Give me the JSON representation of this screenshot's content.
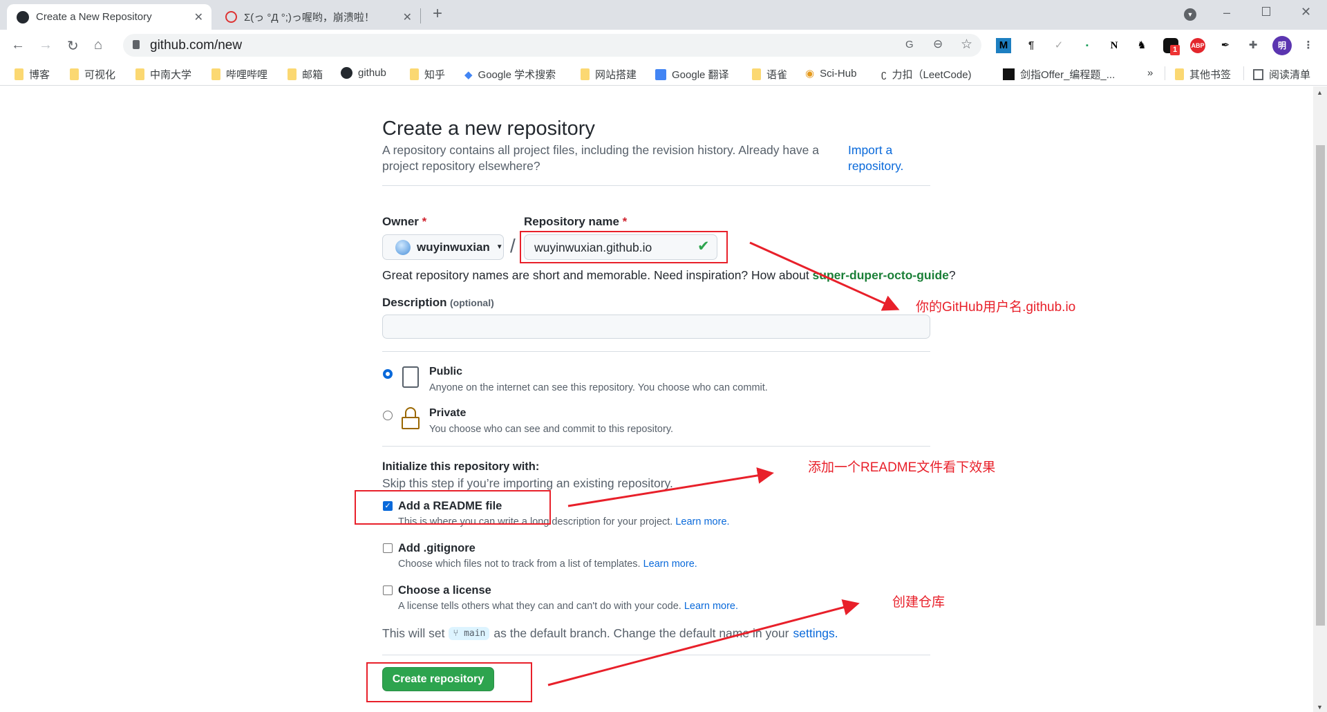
{
  "browser": {
    "tabs": [
      {
        "title": "Create a New Repository",
        "icon": "github-icon"
      },
      {
        "title": "Σ(っ °Д °;)っ喔哟，崩溃啦！",
        "icon": "bilibili-icon"
      }
    ],
    "new_tab": "+",
    "url": "github.com/new",
    "bookmarks": [
      "博客",
      "可视化",
      "中南大学",
      "哔哩哔哩",
      "邮箱",
      "github",
      "知乎",
      "Google 学术搜索",
      "网站搭建",
      "Google 翻译",
      "语雀",
      "Sci-Hub",
      "力扣（LeetCode)",
      "剑指Offer_编程题_..."
    ],
    "bookmarks_overflow": "»",
    "other_bookmarks": "其他书签",
    "reading_list": "阅读清单",
    "profile_initial": "明",
    "extension_badge": "1",
    "extensions": [
      "M",
      "¶",
      "✓",
      "▪",
      "N",
      "ABP"
    ]
  },
  "page": {
    "title": "Create a new repository",
    "subtitle": "A repository contains all project files, including the revision history. Already have a project repository elsewhere?",
    "import_link": "Import a repository.",
    "owner_label": "Owner",
    "required_mark": "*",
    "owner_value": "wuyinwuxian",
    "slash": "/",
    "repo_label": "Repository name",
    "repo_value": "wuyinwuxian.github.io",
    "hint_prefix": "Great repository names are short and memorable. Need inspiration? How about ",
    "hint_suggestion": "super-duper-octo-guide",
    "hint_suffix": "?",
    "description_label": "Description",
    "description_optional": "(optional)",
    "description_value": "",
    "visibility": [
      {
        "label": "Public",
        "desc": "Anyone on the internet can see this repository. You choose who can commit.",
        "selected": true
      },
      {
        "label": "Private",
        "desc": "You choose who can see and commit to this repository.",
        "selected": false
      }
    ],
    "init_title": "Initialize this repository with:",
    "init_skip": "Skip this step if you’re importing an existing repository.",
    "init_options": [
      {
        "label": "Add a README file",
        "desc": "This is where you can write a long description for your project.",
        "link": "Learn more.",
        "checked": true
      },
      {
        "label": "Add .gitignore",
        "desc": "Choose which files not to track from a list of templates.",
        "link": "Learn more.",
        "checked": false
      },
      {
        "label": "Choose a license",
        "desc": "A license tells others what they can and can't do with your code.",
        "link": "Learn more.",
        "checked": false
      }
    ],
    "branch_prefix": "This will set",
    "branch_name": "main",
    "branch_suffix": "as the default branch. Change the default name in your",
    "branch_link": "settings.",
    "create_button": "Create repository"
  },
  "annotations": {
    "repo_name_note": "你的GitHub用户名.github.io",
    "readme_note": "添加一个README文件看下效果",
    "create_note": "创建仓库",
    "color": "#e8202a"
  }
}
